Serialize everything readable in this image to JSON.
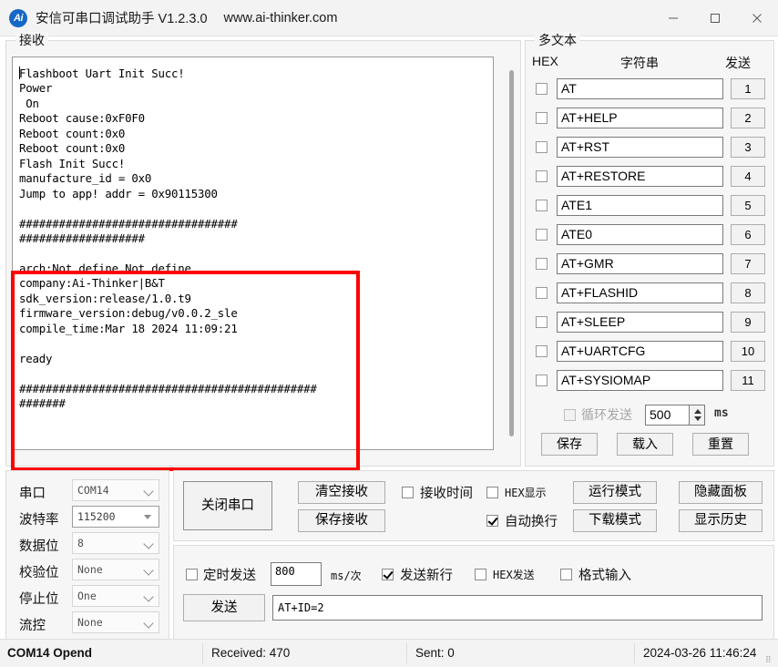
{
  "window": {
    "icon": "ai-thinker-logo-icon",
    "title": "安信可串口调试助手 V1.2.3.0",
    "url": "www.ai-thinker.com",
    "minimize": "minimize-icon",
    "maximize": "maximize-icon",
    "close": "close-icon"
  },
  "receive": {
    "group_label": "接收",
    "text": "Flashboot Uart Init Succ!\nPower\n On\nReboot cause:0xF0F0\nReboot count:0x0\nReboot count:0x0\nFlash Init Succ!\nmanufacture_id = 0x0\nJump to app! addr = 0x90115300\n\n#################################\n###################\n\narch:Not define,Not define\ncompany:Ai-Thinker|B&T\nsdk_version:release/1.0.t9\nfirmware_version:debug/v0.0.2_sle\ncompile_time:Mar 18 2024 11:09:21\n\nready\n\n#############################################\n#######"
  },
  "multitext": {
    "group_label": "多文本",
    "col_hex": "HEX",
    "col_string": "字符串",
    "col_send": "发送",
    "rows": [
      {
        "hex": false,
        "command": "AT",
        "send": "1"
      },
      {
        "hex": false,
        "command": "AT+HELP",
        "send": "2"
      },
      {
        "hex": false,
        "command": "AT+RST",
        "send": "3"
      },
      {
        "hex": false,
        "command": "AT+RESTORE",
        "send": "4"
      },
      {
        "hex": false,
        "command": "ATE1",
        "send": "5"
      },
      {
        "hex": false,
        "command": "ATE0",
        "send": "6"
      },
      {
        "hex": false,
        "command": "AT+GMR",
        "send": "7"
      },
      {
        "hex": false,
        "command": "AT+FLASHID",
        "send": "8"
      },
      {
        "hex": false,
        "command": "AT+SLEEP",
        "send": "9"
      },
      {
        "hex": false,
        "command": "AT+UARTCFG",
        "send": "10"
      },
      {
        "hex": false,
        "command": "AT+SYSIOMAP",
        "send": "11"
      }
    ],
    "loop_label": "循环发送",
    "loop_checked": false,
    "loop_value": "500",
    "loop_unit": "ms",
    "save_label": "保存",
    "load_label": "载入",
    "reset_label": "重置"
  },
  "settings": {
    "rows": [
      {
        "label": "串口",
        "value": "COM14"
      },
      {
        "label": "波特率",
        "value": "115200"
      },
      {
        "label": "数据位",
        "value": "8"
      },
      {
        "label": "校验位",
        "value": "None"
      },
      {
        "label": "停止位",
        "value": "One"
      },
      {
        "label": "流控",
        "value": "None"
      }
    ]
  },
  "controls": {
    "open_close_label": "关闭串口",
    "clear_recv_label": "清空接收",
    "save_recv_label": "保存接收",
    "recv_time_label": "接收时间",
    "recv_time_checked": false,
    "hex_show_label": "HEX显示",
    "hex_show_checked": false,
    "auto_newline_label": "自动换行",
    "auto_newline_checked": true,
    "run_mode_label": "运行模式",
    "download_mode_label": "下载模式",
    "hide_panel_label": "隐藏面板",
    "show_history_label": "显示历史"
  },
  "send": {
    "timed_label": "定时发送",
    "timed_checked": false,
    "interval": "800",
    "interval_unit": "ms/次",
    "newline_label": "发送新行",
    "newline_checked": true,
    "hex_label": "HEX发送",
    "hex_checked": false,
    "format_label": "格式输入",
    "format_checked": false,
    "send_button": "发送",
    "input_value": "AT+ID=2"
  },
  "statusbar": {
    "connection": "COM14 Opend",
    "received": "Received: 470",
    "sent": "Sent: 0",
    "datetime": "2024-03-26 11:46:24"
  },
  "colors": {
    "highlight_box": "#ff0000",
    "accent": "#1668c5"
  }
}
